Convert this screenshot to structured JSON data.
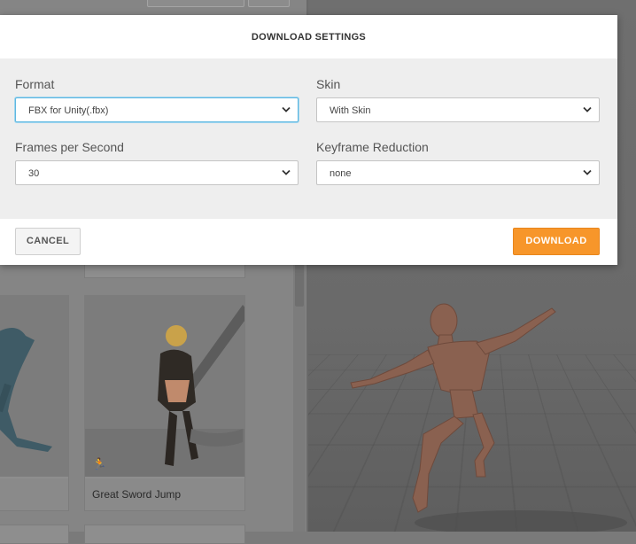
{
  "dialog": {
    "title": "DOWNLOAD SETTINGS",
    "format": {
      "label": "Format",
      "value": "FBX for Unity(.fbx)"
    },
    "skin": {
      "label": "Skin",
      "value": "With Skin"
    },
    "fps": {
      "label": "Frames per Second",
      "value": "30"
    },
    "keyframe": {
      "label": "Keyframe Reduction",
      "value": "none"
    },
    "cancel_label": "CANCEL",
    "download_label": "DOWNLOAD",
    "accent": "#f7962a",
    "focus_color": "#5fb7e0"
  },
  "background": {
    "cards": [
      {
        "caption": ""
      },
      {
        "caption": "Great Sword Jump"
      }
    ]
  }
}
